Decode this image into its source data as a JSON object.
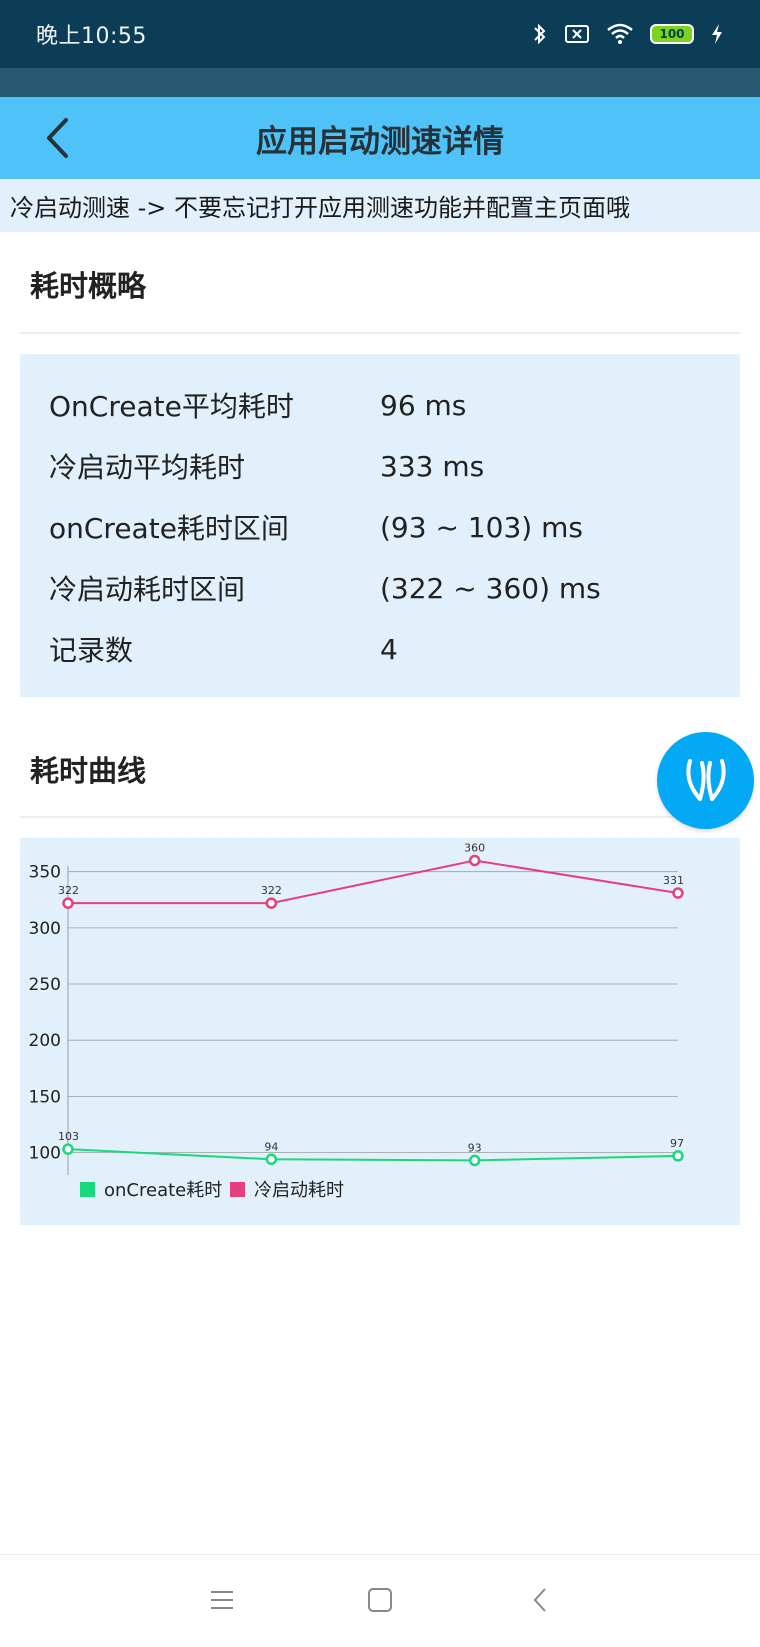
{
  "status_bar": {
    "time": "晚上10:55",
    "battery": "100",
    "icons": [
      "bluetooth-icon",
      "sim-off-icon",
      "wifi-icon",
      "battery-icon",
      "charging-icon"
    ]
  },
  "app_bar": {
    "title": "应用启动测速详情",
    "back_icon": "chevron-left-icon"
  },
  "hint": "冷启动测速 -> 不要忘记打开应用测速功能并配置主页面哦",
  "summary": {
    "title": "耗时概略",
    "rows": [
      {
        "label": "OnCreate平均耗时",
        "value": "96 ms"
      },
      {
        "label": "冷启动平均耗时",
        "value": "333 ms"
      },
      {
        "label": "onCreate耗时区间",
        "value": "(93 ~ 103) ms"
      },
      {
        "label": "冷启动耗时区间",
        "value": "(322 ~ 360) ms"
      },
      {
        "label": "记录数",
        "value": "4"
      }
    ]
  },
  "curve_section": {
    "title": "耗时曲线"
  },
  "colors": {
    "status_bar": "#0b3d56",
    "app_bar": "#4fc3f7",
    "card_bg": "#e1f0fb",
    "fab": "#03a9f4",
    "oncreate_series": "#19d97a",
    "cold_start_series": "#e83e7e"
  },
  "chart_data": {
    "type": "line",
    "x": [
      1,
      2,
      3,
      4
    ],
    "ylim": [
      80,
      380
    ],
    "yticks": [
      100,
      150,
      200,
      250,
      300,
      350
    ],
    "grid": true,
    "legend_position": "bottom-left",
    "series": [
      {
        "name": "onCreate耗时",
        "color": "#19d97a",
        "values": [
          103,
          94,
          93,
          97
        ]
      },
      {
        "name": "冷启动耗时",
        "color": "#e83e7e",
        "values": [
          322,
          322,
          360,
          331
        ]
      }
    ]
  },
  "nav_bar": {
    "icons": [
      "menu-icon",
      "home-icon",
      "back-icon"
    ]
  }
}
